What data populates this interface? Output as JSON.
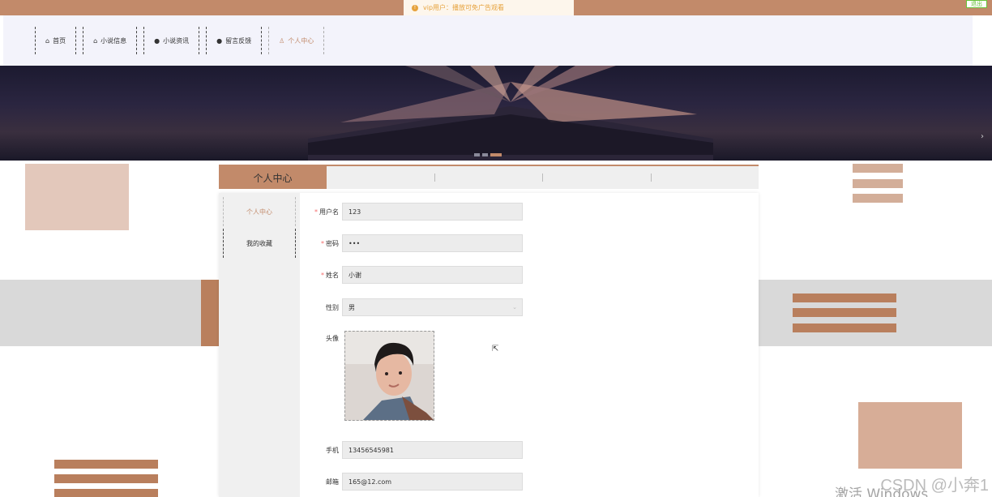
{
  "topbar": {
    "notice": "vip用户：播放可免广告观看",
    "logout_label": "退出"
  },
  "nav": {
    "items": [
      {
        "icon": "home-icon",
        "label": "首页"
      },
      {
        "icon": "book-icon",
        "label": "小说信息"
      },
      {
        "icon": "info-icon",
        "label": "小说资讯"
      },
      {
        "icon": "help-icon",
        "label": "留言反馈"
      },
      {
        "icon": "user-icon",
        "label": "个人中心"
      }
    ]
  },
  "tabs": {
    "active_label": "个人中心"
  },
  "sidemenu": {
    "items": [
      {
        "label": "个人中心"
      },
      {
        "label": "我的收藏"
      }
    ]
  },
  "form": {
    "username": {
      "label": "用户名",
      "value": "123"
    },
    "password": {
      "label": "密码",
      "value": "•••"
    },
    "name": {
      "label": "姓名",
      "value": "小谢"
    },
    "gender": {
      "label": "性别",
      "value": "男"
    },
    "avatar": {
      "label": "头像"
    },
    "phone": {
      "label": "手机",
      "value": "13456545981"
    },
    "email": {
      "label": "邮箱",
      "value": "165@12.com"
    }
  },
  "watermark": {
    "csdn": "CSDN @小奔1",
    "windows": "激活 Windows"
  },
  "colors": {
    "accent": "#c28a6a",
    "nav_bg": "#f3f3fb",
    "required": "#f56c6c"
  }
}
